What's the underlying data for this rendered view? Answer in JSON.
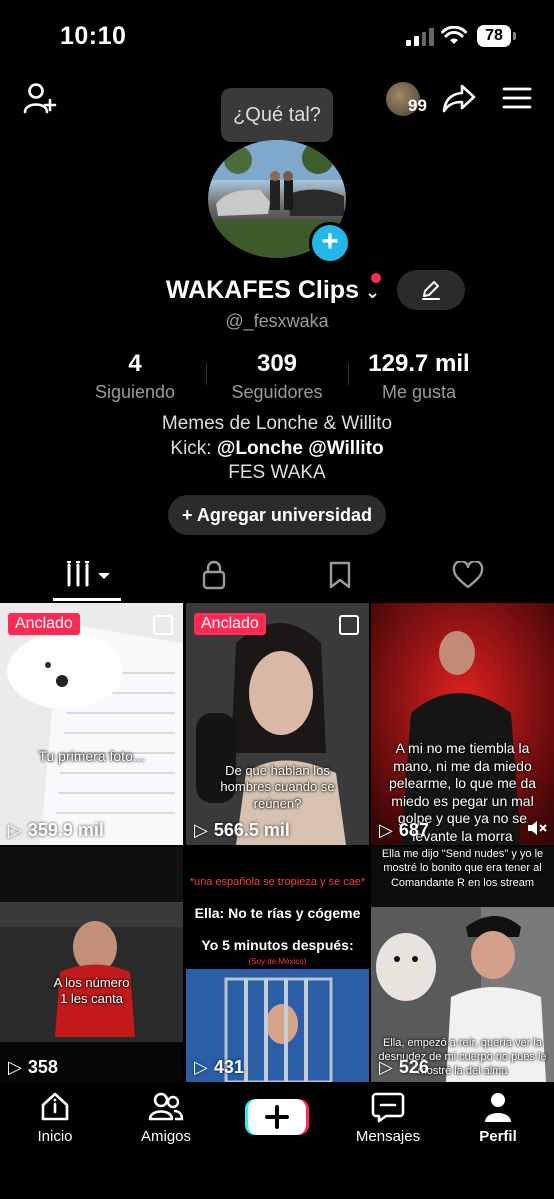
{
  "status_bar": {
    "time": "10:10",
    "battery": "78"
  },
  "top_bar": {
    "tooltip": "¿Qué tal?",
    "story_count": "99"
  },
  "profile": {
    "name": "WAKAFES Clips",
    "handle": "@_fesxwaka",
    "stats": [
      {
        "value": "4",
        "label": "Siguiendo"
      },
      {
        "value": "309",
        "label": "Seguidores"
      },
      {
        "value": "129.7 mil",
        "label": "Me gusta"
      }
    ],
    "bio": {
      "line1": "Memes de Lonche & Willito",
      "line2_prefix": "Kick: ",
      "line2_mentions": "@Lonche @Willito",
      "line3": "FES WAKA"
    },
    "university_button": "+ Agregar universidad"
  },
  "videos": [
    {
      "pinned": "Anclado",
      "caption": "Tu primera foto...",
      "views": "359.9 mil"
    },
    {
      "pinned": "Anclado",
      "caption": "De que hablan los hombres cuando se reúnen?",
      "views": "566.5 mil"
    },
    {
      "caption": "A mi no me tiembla la mano, ni me da miedo pelearme, lo que me da miedo es pegar un mal golpe y que ya no se levante la morra",
      "views": "687"
    },
    {
      "caption": "A los número 1 les canta",
      "views": "358"
    },
    {
      "top_text": "*una española se tropieza y se cae*",
      "caption": "Ella: No te rías y cógeme",
      "caption2": "Yo 5 minutos después:",
      "small": "(Soy de México)",
      "views": "431"
    },
    {
      "top_text": "Ella me dijo \"Send nudes\" y yo le mostré lo bonito que era tener al Comandante R en los stream",
      "caption": "Ella, empezó a reír, quería ver la desnudez de mi cuerpo no pues le mostré la del alma",
      "views": "526"
    }
  ],
  "nav": {
    "home": "Inicio",
    "friends": "Amigos",
    "messages": "Mensajes",
    "profile": "Perfil"
  },
  "colors": {
    "accent": "#fe2c55",
    "cyan": "#22b6e9",
    "muted": "#9a9a9a"
  }
}
